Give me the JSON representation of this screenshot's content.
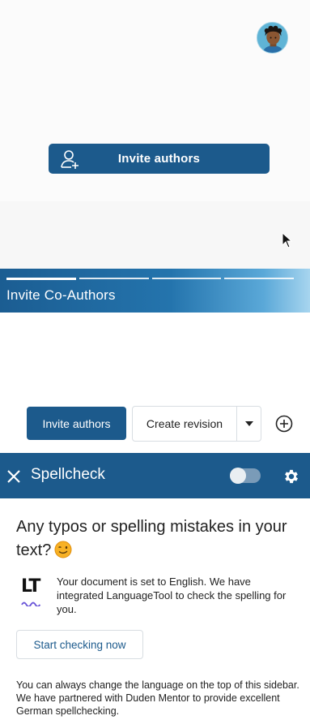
{
  "onboarding": {
    "invite_button_label": "Invite authors",
    "caption": "Invite Co-Authors",
    "progress_steps": 4,
    "active_step": 1
  },
  "toolbar": {
    "invite_label": "Invite authors",
    "create_revision_label": "Create revision",
    "add_icon": "plus-circle-icon"
  },
  "spellcheck": {
    "title": "Spellcheck",
    "toggle_on": false,
    "heading": "Any typos or spelling mistakes in your text?",
    "logo_text": "LT",
    "info": "Your document is set to English. We have integrated LanguageTool to check the spelling for you.",
    "start_label": "Start checking now",
    "note": "You can always change the language on the top of this sidebar. We have partnered with Duden Mentor to provide excellent German spellchecking."
  },
  "colors": {
    "primary": "#1c5a8c",
    "footer_gradient_end": "#a7d5ef",
    "emoji": "#f7b125"
  }
}
